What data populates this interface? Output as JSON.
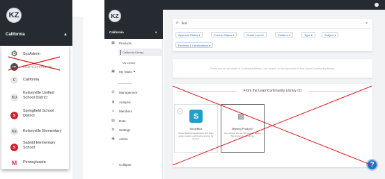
{
  "left_panel": {
    "avatar": "KZ",
    "org_name": "California",
    "caret": "▲",
    "items": [
      {
        "label": "SysAdmin",
        "icon": "gear-icon",
        "initials": ""
      },
      {
        "label": "LearnCommunity",
        "icon": "learncommunity-logo-icon",
        "initials": "•••",
        "crossed_out": true
      },
      {
        "label": "California",
        "icon": "org-initial-icon",
        "initials": "C"
      },
      {
        "label": "Kelseyville Unified School District",
        "icon": "org-initial-icon",
        "initials": "KU"
      },
      {
        "label": "Springfield School District",
        "icon": "school-logo-icon",
        "initials": "S"
      },
      {
        "label": "Kelseyville Elementary",
        "icon": "org-initial-icon",
        "initials": "KE"
      },
      {
        "label": "Saboid Elementary School",
        "icon": "school-logo-icon",
        "initials": "S"
      },
      {
        "label": "Pennsylvania",
        "icon": "pennsylvania-logo-icon",
        "initials": "M"
      }
    ]
  },
  "app": {
    "avatar": "KZ",
    "org_name": "California",
    "caret": "▾",
    "nav": {
      "products": "Products",
      "california_library": "California Library",
      "my_library": "My Library",
      "my_tasks": "My Tasks",
      "management": "Management",
      "analysis": "Analysis",
      "members": "Members",
      "data": "Data",
      "settings": "Settings",
      "admin": "Admin",
      "collapse": "Collapse"
    },
    "search": {
      "value": "find",
      "clear": "×"
    },
    "filters": [
      "Approval Status ▾",
      "Product Status ▾",
      "Grade Level ▾",
      "Platform ▾",
      "Type ▾",
      "Subject ▾",
      "Reviews & Certifications ▾"
    ],
    "empty_message": "There are no products in California library. Use search to find products in the LearnCommunity library.",
    "library_heading": "From the LearnCommunity Library (1)",
    "tiles": [
      {
        "name": "StudyBlue",
        "description": "Online flashcard application and study guide creation and sharing service for student."
      },
      {
        "name": "Missing Product?",
        "description": "Let us know and we will work on adding that product to our Library."
      }
    ],
    "help": "?"
  },
  "colors": {
    "dark_header": "#262b31",
    "accent_blue": "#2b6fc0",
    "annotation_red": "#e0141b"
  }
}
